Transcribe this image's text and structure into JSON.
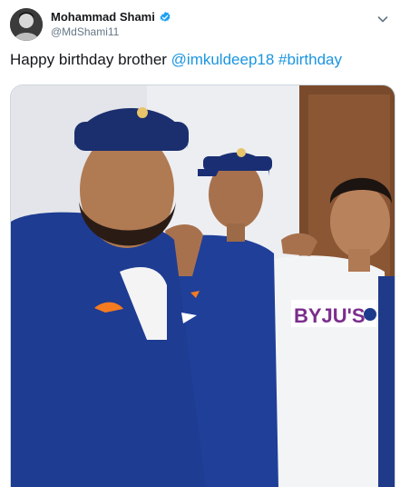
{
  "tweet": {
    "author": {
      "display_name": "Mohammad Shami",
      "handle": "@MdShami11",
      "avatar_icon": "profile-photo",
      "verified": true,
      "verified_icon": "verified-badge-icon",
      "verified_color": "#1da1f2"
    },
    "text_plain": "Happy birthday brother ",
    "mention": "@imkuldeep18",
    "hashtag": "#birthday",
    "link_color": "#1b95e0",
    "menu_icon": "chevron-down-icon",
    "media": {
      "type": "photo",
      "jersey_sponsor": "BYJU'S"
    }
  }
}
